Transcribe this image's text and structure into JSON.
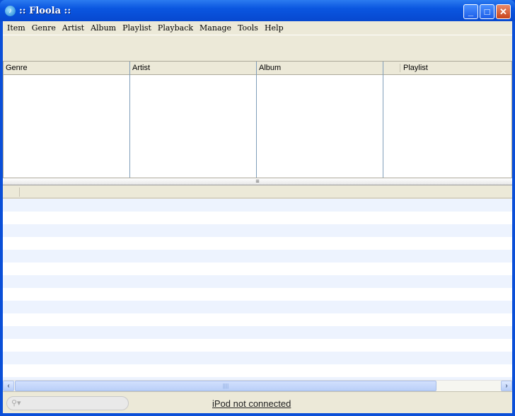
{
  "window": {
    "title": ":: Floola ::",
    "minimize": "_",
    "maximize": "□",
    "close": "✕"
  },
  "menu": [
    "Item",
    "Genre",
    "Artist",
    "Album",
    "Playlist",
    "Playback",
    "Manage",
    "Tools",
    "Help"
  ],
  "panes": {
    "genre": "Genre",
    "artist": "Artist",
    "album": "Album",
    "playlist": "Playlist"
  },
  "scroll": {
    "left": "‹",
    "right": "›",
    "grip": "||||"
  },
  "status": {
    "ipod": "iPod not connected",
    "search_icon": "search-icon"
  },
  "colors": {
    "titlebar": "#0a56e0",
    "stripe": "#edf3fe"
  }
}
